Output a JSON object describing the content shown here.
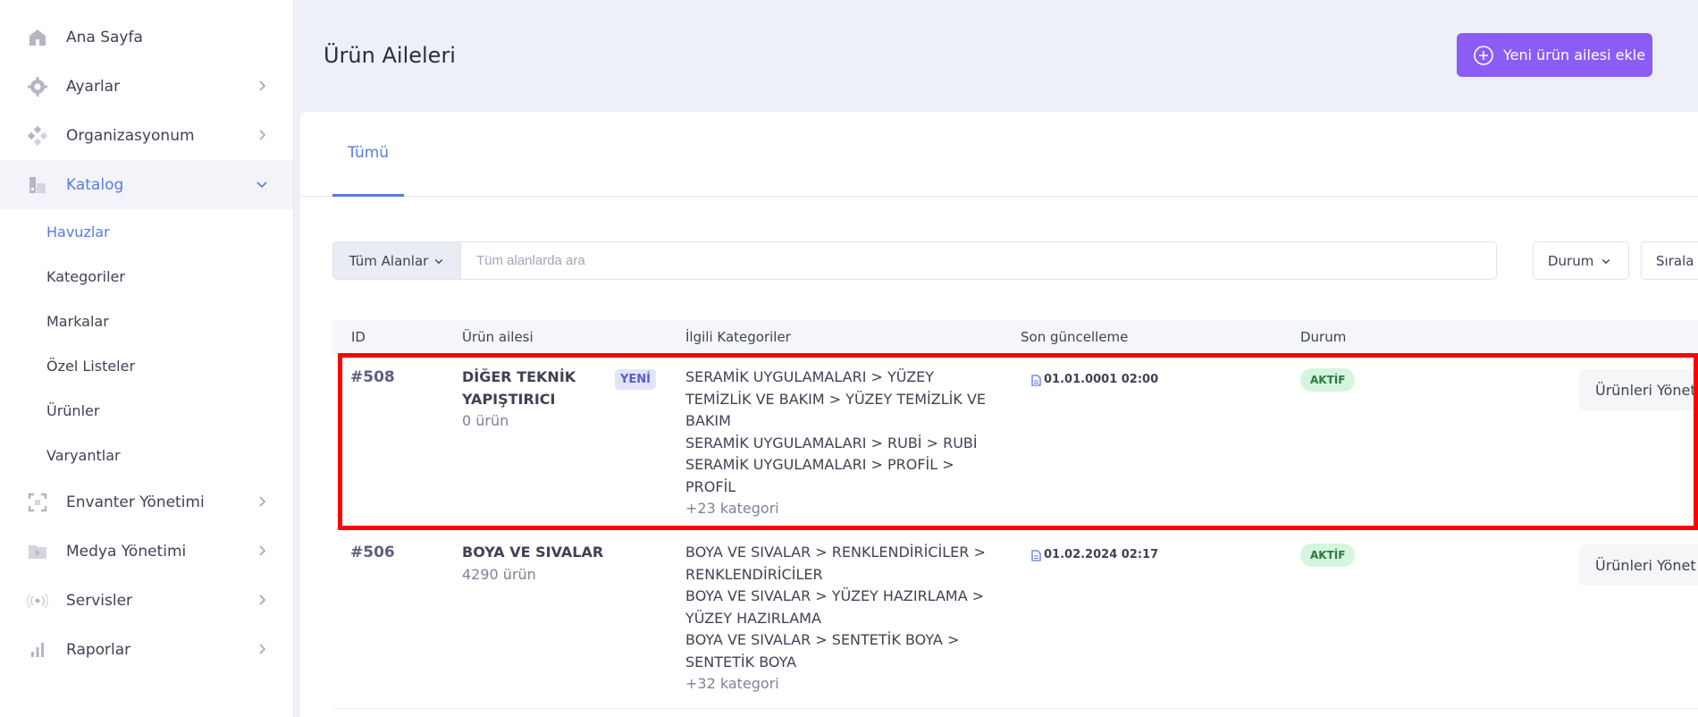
{
  "sidebar": {
    "items": [
      {
        "label": "Ana Sayfa",
        "icon": "home-icon"
      },
      {
        "label": "Ayarlar",
        "icon": "gear-icon"
      },
      {
        "label": "Organizasyonum",
        "icon": "organization-icon"
      },
      {
        "label": "Katalog",
        "icon": "catalog-icon"
      },
      {
        "label": "Envanter Yönetimi",
        "icon": "inventory-icon"
      },
      {
        "label": "Medya Yönetimi",
        "icon": "media-folder-icon"
      },
      {
        "label": "Servisler",
        "icon": "services-icon"
      },
      {
        "label": "Raporlar",
        "icon": "reports-icon"
      }
    ],
    "catalog_sub": [
      "Havuzlar",
      "Kategoriler",
      "Markalar",
      "Özel Listeler",
      "Ürünler",
      "Varyantlar"
    ]
  },
  "header": {
    "title": "Ürün Aileleri",
    "add_button": "Yeni ürün ailesi ekle"
  },
  "tabs": [
    "Tümü"
  ],
  "search": {
    "scope": "Tüm Alanlar",
    "placeholder": "Tüm alanlarda ara",
    "status_filter": "Durum",
    "sort": "Sırala"
  },
  "table": {
    "headers": [
      "ID",
      "Ürün ailesi",
      "İlgili Kategoriler",
      "Son güncelleme",
      "Durum"
    ],
    "rows": [
      {
        "id": "#508",
        "name_line1": "DİĞER TEKNİK",
        "name_line2": "YAPIŞTIRICI",
        "count": "0 ürün",
        "badge": "YENİ",
        "cat_lines": [
          "SERAMİK UYGULAMALARI > YÜZEY",
          "TEMİZLİK VE BAKIM > YÜZEY TEMİZLİK VE",
          "BAKIM",
          "SERAMİK UYGULAMALARI > RUBİ > RUBİ",
          "SERAMİK UYGULAMALARI > PROFİL >",
          "PROFİL"
        ],
        "more": "+23 kategori",
        "updated": "01.01.0001 02:00",
        "status": "AKTİF",
        "action": "Ürünleri Yönet"
      },
      {
        "id": "#506",
        "name_line1": "BOYA VE SIVALAR",
        "count": "4290 ürün",
        "cat_lines": [
          "BOYA VE SIVALAR > RENKLENDİRİCİLER >",
          "RENKLENDİRİCİLER",
          "BOYA VE SIVALAR > YÜZEY HAZIRLAMA >",
          "YÜZEY HAZIRLAMA",
          "BOYA VE SIVALAR > SENTETİK BOYA >",
          "SENTETİK BOYA"
        ],
        "more": "+32 kategori",
        "updated": "01.02.2024 02:17",
        "status": "AKTİF",
        "action": "Ürünleri Yönet"
      }
    ]
  },
  "colors": {
    "accent": "#5a7be0",
    "primary_button": "#8b5cf6",
    "status_active_bg": "#d4f5de",
    "highlight": "#ff0000"
  }
}
